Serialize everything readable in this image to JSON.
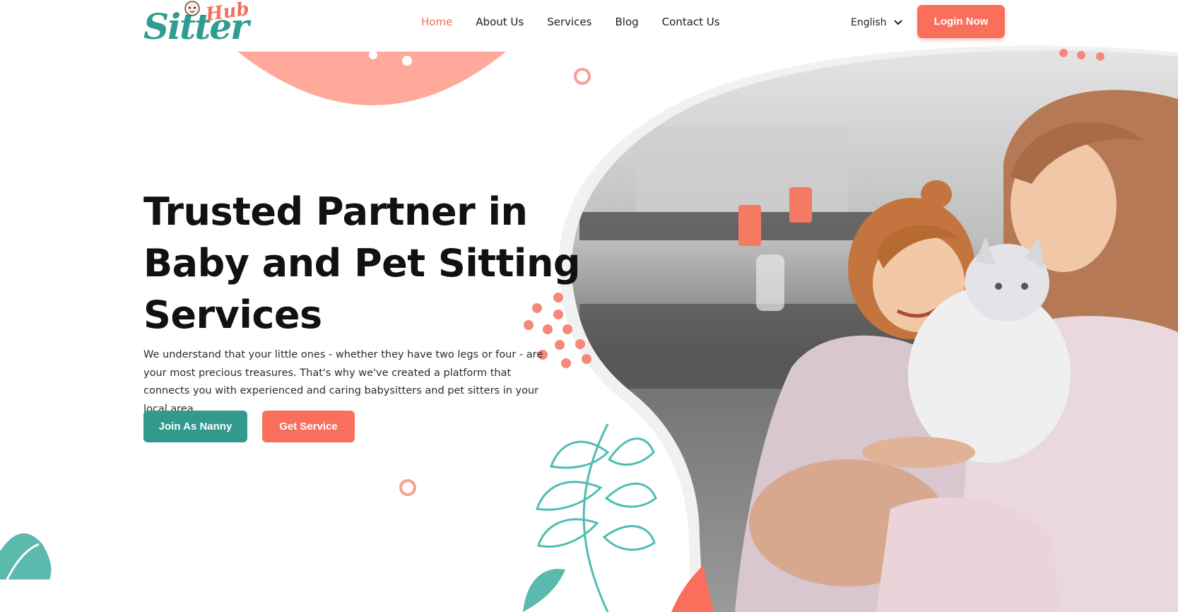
{
  "brand": {
    "logo_word": "Sitter",
    "logo_sub": "Hub",
    "colors": {
      "teal": "#32998d",
      "coral": "#fa6f5c",
      "peach": "#fea99a"
    }
  },
  "nav": {
    "items": [
      {
        "label": "Home",
        "active": true
      },
      {
        "label": "About Us"
      },
      {
        "label": "Services"
      },
      {
        "label": "Blog"
      },
      {
        "label": "Contact Us"
      }
    ]
  },
  "language": {
    "selected": "English",
    "icon": "chevron-down-icon"
  },
  "header": {
    "login_label": "Login Now"
  },
  "hero": {
    "title_lines": [
      "Trusted Partner in",
      "Baby and Pet Sitting",
      "Services"
    ],
    "description": "We understand that your little ones - whether they have two legs or four - are your most precious treasures. That's why we've created a platform that connects you with experienced and caring babysitters and pet sitters in your local area.",
    "primary_button": "Join As Nanny",
    "secondary_button": "Get Service"
  }
}
